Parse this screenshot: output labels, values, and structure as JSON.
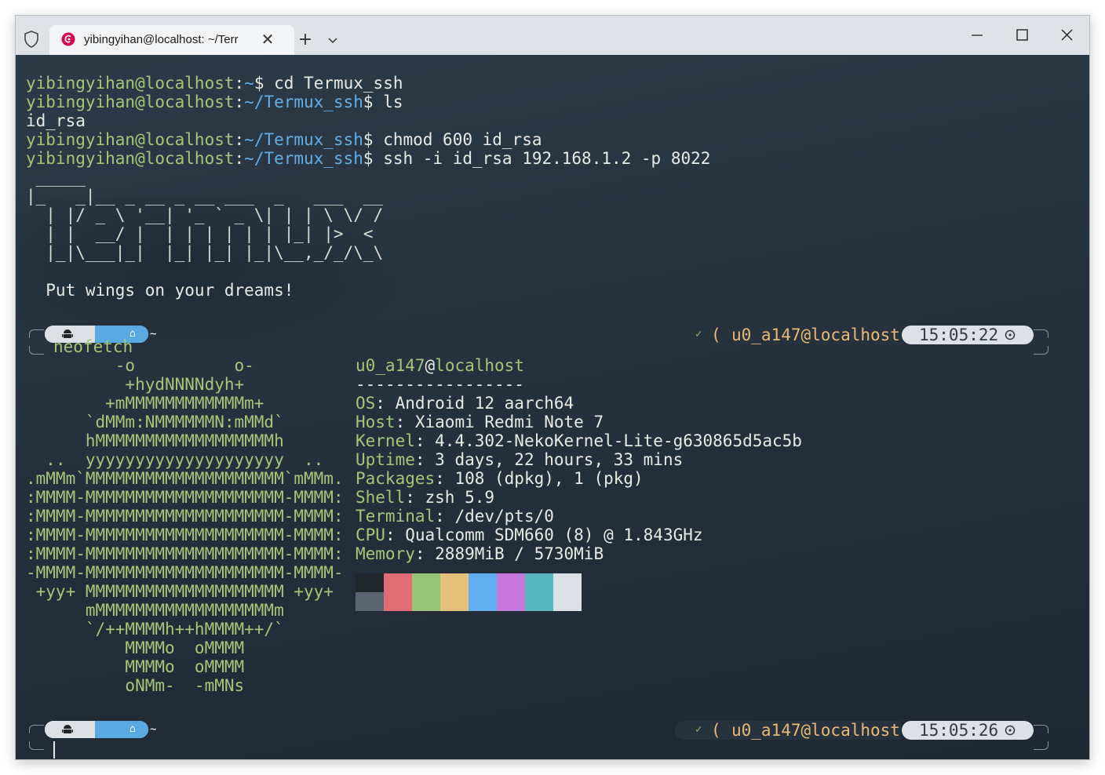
{
  "window": {
    "tab_title": "yibingyihan@localhost: ~/Terr",
    "icons": {
      "shield": "shield-icon",
      "favicon": "debian-icon",
      "close": "close-icon",
      "new_tab": "plus-icon",
      "dropdown": "chevron-down-icon",
      "minimize": "minimize-icon",
      "maximize": "maximize-icon",
      "window_close": "close-icon"
    },
    "close_glyph": "✕",
    "new_tab_glyph": "+"
  },
  "terminal": {
    "commands": [
      {
        "user": "yibingyihan@localhost",
        "sep": ":",
        "path": "~",
        "prompt": "$",
        "cmd": " cd Termux_ssh"
      },
      {
        "user": "yibingyihan@localhost",
        "sep": ":",
        "path": "~/Termux_ssh",
        "prompt": "$",
        "cmd": " ls"
      },
      {
        "output": "id_rsa"
      },
      {
        "user": "yibingyihan@localhost",
        "sep": ":",
        "path": "~/Termux_ssh",
        "prompt": "$",
        "cmd": " chmod 600 id_rsa"
      },
      {
        "user": "yibingyihan@localhost",
        "sep": ":",
        "path": "~/Termux_ssh",
        "prompt": "$",
        "cmd": " ssh -i id_rsa 192.168.1.2 -p 8022"
      }
    ],
    "banner": " _____\n|_   _|__ _ __ _ __ ___  _   ___  __\n  | |/ _ \\ '__| '_ ` _ \\| | | \\ \\/ /\n  | |  __/ |  | | | | | | |_| |>  <\n  |_|\\___|_|  |_| |_| |_|\\__,_/_/\\_\\",
    "motto": "  Put wings on your dreams!",
    "prompt1": {
      "home_glyph": "⌂",
      "tilde": "~",
      "check": "✓",
      "paren": "(",
      "host": "u0_a147@localhost",
      "time": "15:05:22",
      "cmd": "neofetch"
    },
    "prompt2": {
      "home_glyph": "⌂",
      "tilde": "~",
      "check": "✓",
      "paren": "(",
      "host": "u0_a147@localhost",
      "time": "15:05:26"
    },
    "logo": [
      "         -o          o-",
      "          +hydNNNNdyh+",
      "        +mMMMMMMMMMMMMm+",
      "      `dMMm:NMMMMMMN:mMMd`",
      "      hMMMMMMMMMMMMMMMMMMh",
      "  ..  yyyyyyyyyyyyyyyyyyyy  ..",
      ".mMMm`MMMMMMMMMMMMMMMMMMMM`mMMm.",
      ":MMMM-MMMMMMMMMMMMMMMMMMMM-MMMM:",
      ":MMMM-MMMMMMMMMMMMMMMMMMMM-MMMM:",
      ":MMMM-MMMMMMMMMMMMMMMMMMMM-MMMM:",
      ":MMMM-MMMMMMMMMMMMMMMMMMMM-MMMM:",
      "-MMMM-MMMMMMMMMMMMMMMMMMMM-MMMM-",
      " +yy+ MMMMMMMMMMMMMMMMMMMM +yy+",
      "      mMMMMMMMMMMMMMMMMMMm",
      "      `/++MMMMh++hMMMM++/`",
      "          MMMMo  oMMMM",
      "          MMMMo  oMMMM",
      "          oNMm-  -mMNs"
    ],
    "info": {
      "user": "u0_a147",
      "at": "@",
      "host": "localhost",
      "separator": "-----------------",
      "fields": [
        {
          "key": "OS",
          "value": "Android 12 aarch64"
        },
        {
          "key": "Host",
          "value": "Xiaomi Redmi Note 7"
        },
        {
          "key": "Kernel",
          "value": "4.4.302-NekoKernel-Lite-g630865d5ac5b"
        },
        {
          "key": "Uptime",
          "value": "3 days, 22 hours, 33 mins"
        },
        {
          "key": "Packages",
          "value": "108 (dpkg), 1 (pkg)"
        },
        {
          "key": "Shell",
          "value": "zsh 5.9"
        },
        {
          "key": "Terminal",
          "value": "/dev/pts/0"
        },
        {
          "key": "CPU",
          "value": "Qualcomm SDM660 (8) @ 1.843GHz"
        },
        {
          "key": "Memory",
          "value": "2889MiB / 5730MiB"
        }
      ],
      "palette_top": [
        "#22272e",
        "#e06c75",
        "#98c379",
        "#e5c07b",
        "#61afef",
        "#c678dd",
        "#56b6c2",
        "#dcdfe4"
      ],
      "palette_bottom": [
        "#5c6370"
      ]
    }
  }
}
